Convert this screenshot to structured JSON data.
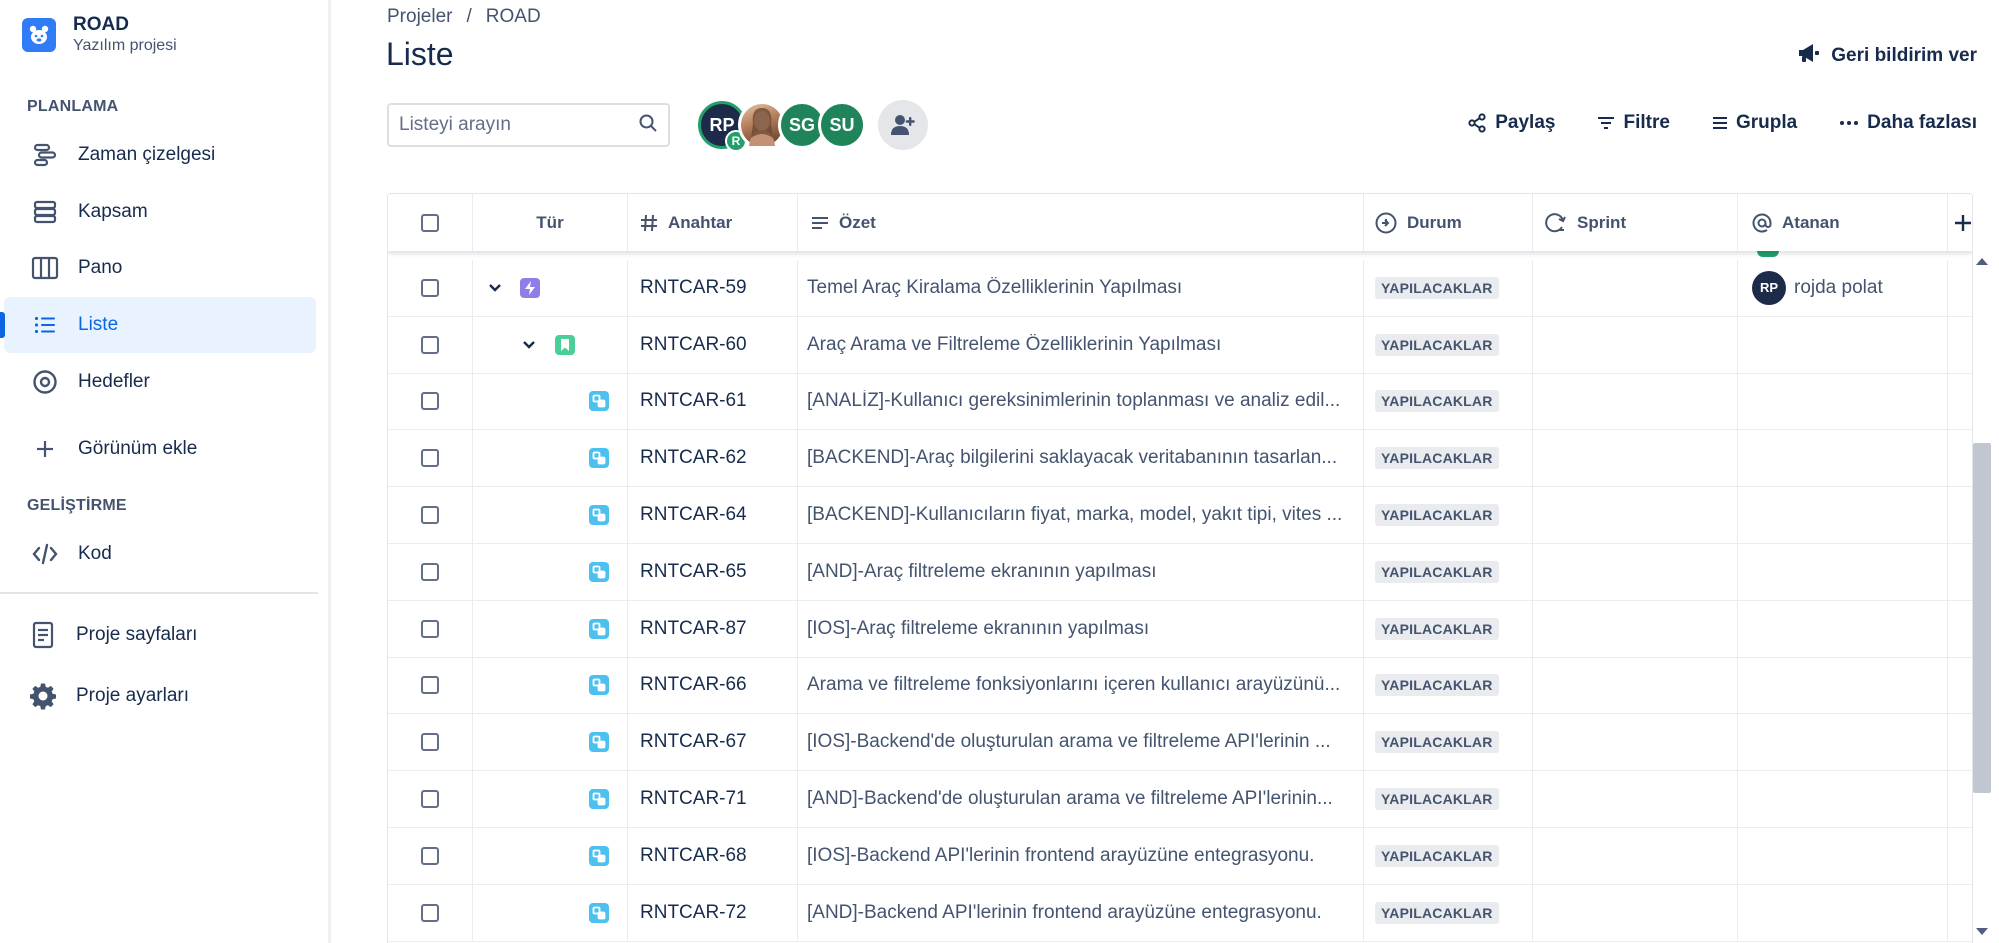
{
  "project": {
    "name": "ROAD",
    "type": "Yazılım projesi"
  },
  "sidebar": {
    "planning_label": "PLANLAMA",
    "dev_label": "GELİŞTİRME",
    "items": [
      {
        "label": "Zaman çizelgesi",
        "icon": "timeline-icon"
      },
      {
        "label": "Kapsam",
        "icon": "backlog-icon"
      },
      {
        "label": "Pano",
        "icon": "board-icon"
      },
      {
        "label": "Liste",
        "icon": "list-icon",
        "active": true
      },
      {
        "label": "Hedefler",
        "icon": "goals-icon"
      },
      {
        "label": "Görünüm ekle",
        "icon": "plus-icon"
      },
      {
        "label": "Kod",
        "icon": "code-icon"
      },
      {
        "label": "Proje sayfaları",
        "icon": "pages-icon"
      },
      {
        "label": "Proje ayarları",
        "icon": "settings-icon"
      }
    ]
  },
  "breadcrumb": {
    "parent": "Projeler",
    "separator": "/",
    "current": "ROAD"
  },
  "page_title": "Liste",
  "feedback_label": "Geri bildirim ver",
  "search": {
    "placeholder": "Listeyi arayın",
    "value": ""
  },
  "avatars": {
    "rp": "RP",
    "rp_badge": "R",
    "sg": "SG",
    "su": "SU"
  },
  "actions": {
    "share": "Paylaş",
    "filter": "Filtre",
    "group": "Grupla",
    "more": "Daha fazlası"
  },
  "table": {
    "columns": {
      "type": "Tür",
      "key": "Anahtar",
      "summary": "Özet",
      "status": "Durum",
      "sprint": "Sprint",
      "assignee": "Atanan"
    },
    "rows": [
      {
        "key": "RNTCAR-59",
        "summary": "Temel Araç Kiralama Özelliklerinin Yapılması",
        "status": "YAPILACAKLAR",
        "type": "epic",
        "assignee_initials": "RP",
        "assignee": "rojda polat"
      },
      {
        "key": "RNTCAR-60",
        "summary": "Araç Arama ve Filtreleme Özelliklerinin Yapılması",
        "status": "YAPILACAKLAR",
        "type": "story"
      },
      {
        "key": "RNTCAR-61",
        "summary": "[ANALİZ]-Kullanıcı gereksinimlerinin toplanması ve analiz edil...",
        "status": "YAPILACAKLAR",
        "type": "subtask"
      },
      {
        "key": "RNTCAR-62",
        "summary": "[BACKEND]-Araç bilgilerini saklayacak veritabanının tasarlan...",
        "status": "YAPILACAKLAR",
        "type": "subtask"
      },
      {
        "key": "RNTCAR-64",
        "summary": "[BACKEND]-Kullanıcıların fiyat, marka, model, yakıt tipi, vites ...",
        "status": "YAPILACAKLAR",
        "type": "subtask"
      },
      {
        "key": "RNTCAR-65",
        "summary": "[AND]-Araç filtreleme ekranının yapılması",
        "status": "YAPILACAKLAR",
        "type": "subtask"
      },
      {
        "key": "RNTCAR-87",
        "summary": "[IOS]-Araç filtreleme ekranının yapılması",
        "status": "YAPILACAKLAR",
        "type": "subtask"
      },
      {
        "key": "RNTCAR-66",
        "summary": "Arama ve filtreleme fonksiyonlarını içeren kullanıcı arayüzünü...",
        "status": "YAPILACAKLAR",
        "type": "subtask"
      },
      {
        "key": "RNTCAR-67",
        "summary": "[IOS]-Backend'de oluşturulan arama ve filtreleme API'lerinin ...",
        "status": "YAPILACAKLAR",
        "type": "subtask"
      },
      {
        "key": "RNTCAR-71",
        "summary": "[AND]-Backend'de oluşturulan arama ve filtreleme API'lerinin...",
        "status": "YAPILACAKLAR",
        "type": "subtask"
      },
      {
        "key": "RNTCAR-68",
        "summary": "[IOS]-Backend API'lerinin frontend arayüzüne entegrasyonu.",
        "status": "YAPILACAKLAR",
        "type": "subtask"
      },
      {
        "key": "RNTCAR-72",
        "summary": "[AND]-Backend API'lerinin frontend arayüzüne entegrasyonu.",
        "status": "YAPILACAKLAR",
        "type": "subtask"
      }
    ]
  },
  "colors": {
    "accent": "#0c66e4",
    "epic": "#8f7ee7",
    "story": "#4bce97",
    "subtask": "#4cc1f0"
  }
}
